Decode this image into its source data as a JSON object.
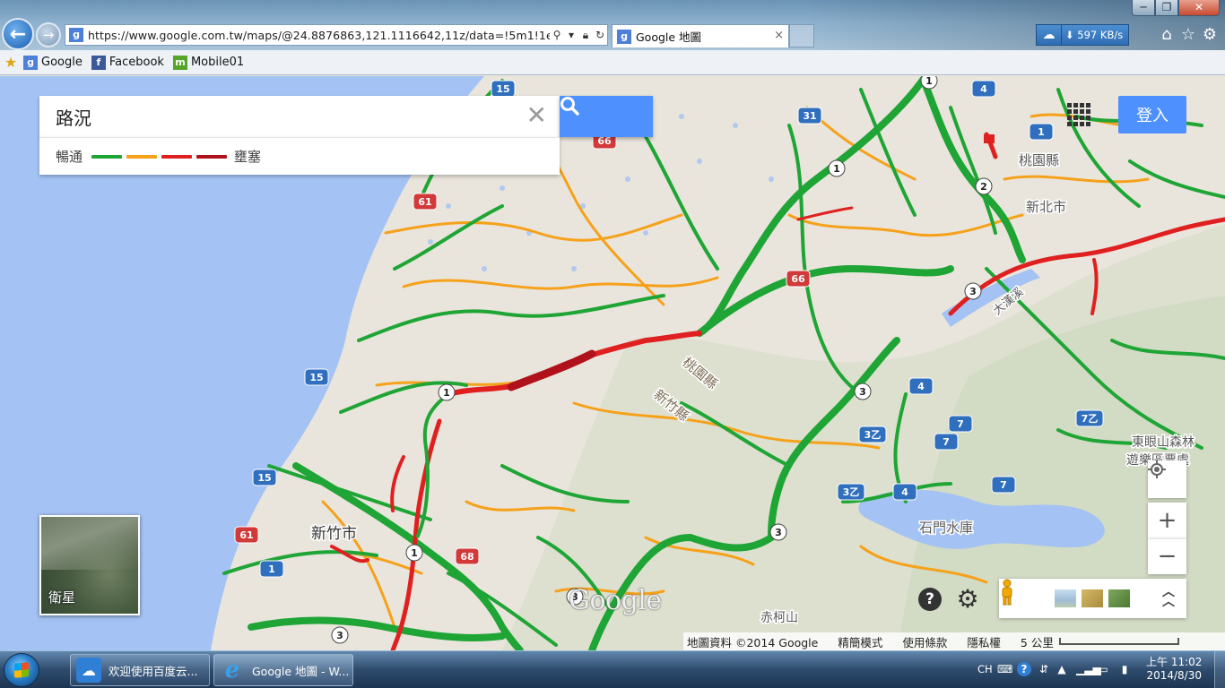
{
  "browser": {
    "url": "https://www.google.com.tw/maps/@24.8876863,121.1116642,11z/data=!5m1!1e1?hl=zh-",
    "tab_title": "Google 地圖",
    "tab_close": "×",
    "back_glyph": "←",
    "forward_glyph": "→",
    "download_speed": "597 KB/s",
    "window_min": "─",
    "window_max": "❐",
    "window_close": "✕",
    "favorites": [
      {
        "label": "Google",
        "icon": "google-icon"
      },
      {
        "label": "Facebook",
        "icon": "facebook-icon"
      },
      {
        "label": "Mobile01",
        "icon": "mobile01-icon"
      }
    ]
  },
  "map": {
    "search_value": "路況",
    "clear_glyph": "✕",
    "legend_fast": "暢通",
    "legend_slow": "壅塞",
    "legend_colors": [
      "#1fa535",
      "#f6a11a",
      "#e02020",
      "#b0121b"
    ],
    "sign_in": "登入",
    "satellite_label": "衛星",
    "zoom_in": "+",
    "zoom_out": "−",
    "help": "?",
    "settings": "⚙",
    "layers_expand": "⌃",
    "logo": "Google",
    "labels": {
      "county_taoyuan_ne": "桃園縣",
      "city_newtaipei": "新北市",
      "river_dahan": "大漢溪",
      "border_taoyuan": "桃園縣",
      "border_hsinchu": "新竹縣",
      "city_hsinchu": "新竹市",
      "reservoir": "石門水庫",
      "forest_line1": "東眼山森林",
      "forest_line2": "遊樂區票處",
      "mountain": "赤柯山"
    },
    "road_shields": {
      "s61a": "61",
      "s61b": "61",
      "s15a": "15",
      "s15b": "15",
      "s15c": "15",
      "s31": "31",
      "s66a": "66",
      "s66b": "66",
      "s68": "68",
      "s1a": "1",
      "s1b": "1",
      "s1c": "1",
      "s1d": "1",
      "s1e": "1",
      "s2": "2",
      "s3a": "3",
      "s3b": "3",
      "s3c": "3",
      "s3d": "3",
      "s3e": "3",
      "s4a": "4",
      "s4b": "4",
      "s4c": "4",
      "s7a": "7",
      "s7b": "7",
      "s7c": "7",
      "s3yi_a": "3乙",
      "s3yi_b": "3乙",
      "s7yi": "7乙"
    },
    "footer": {
      "map_data": "地圖資料 ©2014 Google",
      "lite_mode": "精簡模式",
      "terms": "使用條款",
      "privacy": "隱私權",
      "scale": "5 公里"
    }
  },
  "taskbar": {
    "items": [
      {
        "label": "欢迎使用百度云...",
        "icon": "baidu-cloud-icon"
      },
      {
        "label": "Google 地圖 - W...",
        "icon": "ie-icon"
      }
    ],
    "language": "CH",
    "time": "上午 11:02",
    "date": "2014/8/30"
  }
}
